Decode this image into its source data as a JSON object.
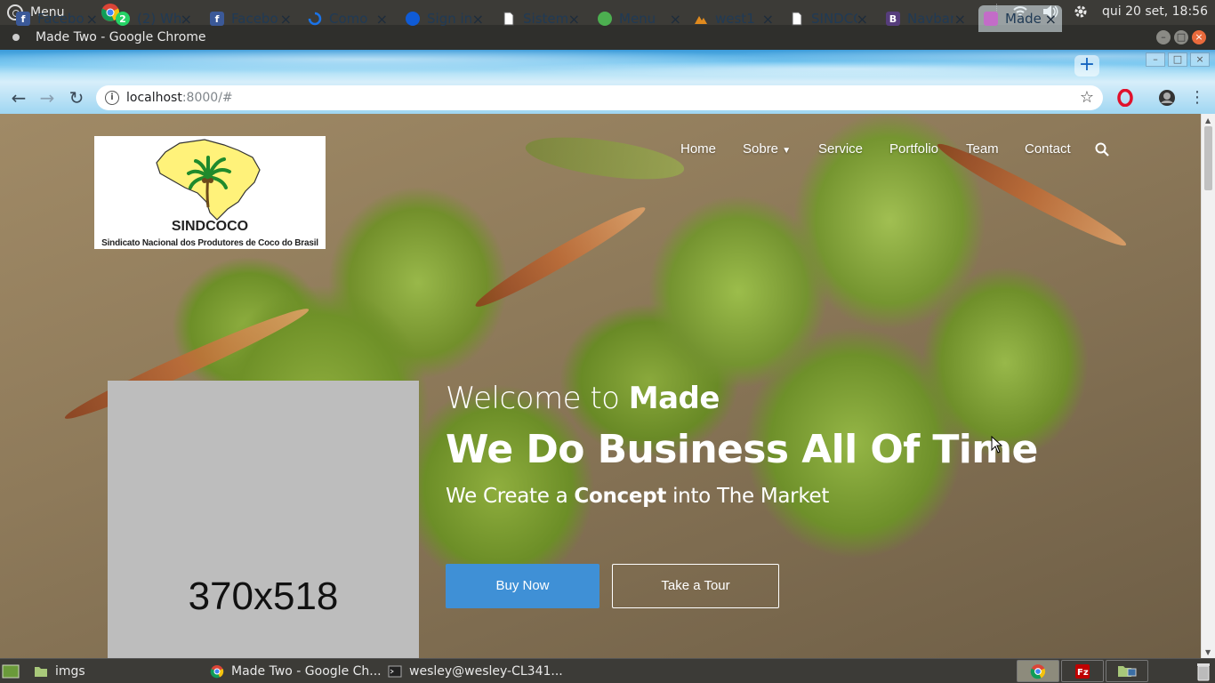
{
  "os": {
    "menu_label": "Menu",
    "clock": "qui 20 set, 18:56"
  },
  "window": {
    "title": "Made Two - Google Chrome",
    "buttons": {
      "minimize": "–",
      "maximize": "□",
      "close": "×"
    }
  },
  "tabs": [
    {
      "label": "Facebook",
      "favicon": "facebook-icon",
      "color": "#3b5998",
      "glyph": "f"
    },
    {
      "label": "(2) WhatsApp",
      "favicon": "whatsapp-icon",
      "color": "#25d366",
      "glyph": "2"
    },
    {
      "label": "Facebook",
      "favicon": "facebook-icon",
      "color": "#3b5998",
      "glyph": "f"
    },
    {
      "label": "Como",
      "favicon": "sync-icon",
      "color": "#1a73e8",
      "glyph": ""
    },
    {
      "label": "Sign in",
      "favicon": "edge-icon",
      "color": "#0f5bd6",
      "glyph": ""
    },
    {
      "label": "Sistema",
      "favicon": "document-icon",
      "color": "#ffffff",
      "glyph": ""
    },
    {
      "label": "Menu",
      "favicon": "puzzle-icon",
      "color": "#4caf50",
      "glyph": ""
    },
    {
      "label": "west1",
      "favicon": "mountain-icon",
      "color": "#e08a1e",
      "glyph": ""
    },
    {
      "label": "SINDCOCO",
      "favicon": "document-icon",
      "color": "#ffffff",
      "glyph": ""
    },
    {
      "label": "Navbar",
      "favicon": "bootstrap-icon",
      "color": "#563d7c",
      "glyph": "B"
    },
    {
      "label": "Made",
      "favicon": "made-icon",
      "color": "#c36cc8",
      "glyph": ""
    }
  ],
  "tab_close": "×",
  "new_tab": "+",
  "address": {
    "host": "localhost",
    "path": ":8000/#",
    "star": "☆"
  },
  "page": {
    "logo": {
      "name": "SINDCOCO",
      "subtitle": "Sindicato Nacional dos Produtores de Coco do Brasil"
    },
    "nav": [
      "Home",
      "Sobre",
      "Service",
      "Portfolio",
      "Team",
      "Contact"
    ],
    "placeholder": "370x518",
    "hero": {
      "welcome_prefix": "Welcome to ",
      "welcome_strong": "Made",
      "headline": "We Do Business All Of Time",
      "tag_prefix": "We Create a ",
      "tag_strong": "Concept",
      "tag_suffix": " into The Market"
    },
    "buttons": {
      "buy": "Buy Now",
      "tour": "Take a Tour"
    }
  },
  "taskbar": [
    {
      "label": "imgs",
      "icon": "folder-icon"
    },
    {
      "label": "Made Two - Google Ch...",
      "icon": "chrome-icon"
    },
    {
      "label": "wesley@wesley-CL341...",
      "icon": "terminal-icon"
    }
  ],
  "colors": {
    "accent_button": "#3f90d6",
    "os_panel": "#3c3b37"
  }
}
